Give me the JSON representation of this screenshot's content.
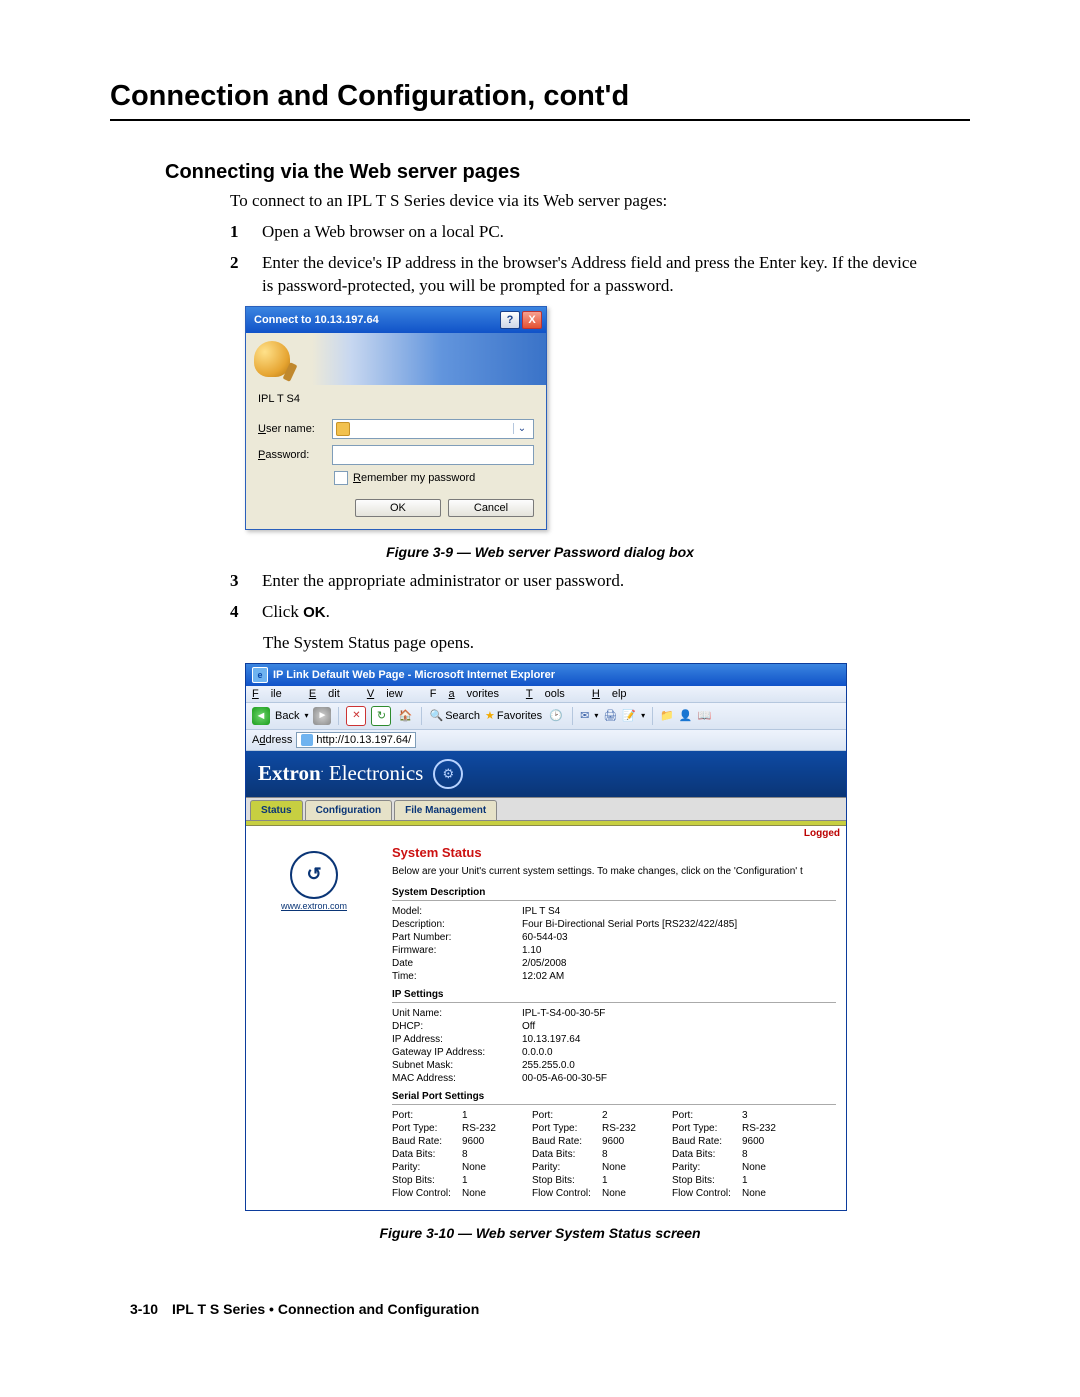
{
  "chapter_title": "Connection and Configuration, cont'd",
  "section_title": "Connecting via the Web server pages",
  "intro": "To connect to an IPL T S Series device via its Web server pages:",
  "steps_a": [
    {
      "n": "1",
      "t": "Open a Web browser on a local PC."
    },
    {
      "n": "2",
      "t": "Enter the device's IP address in the browser's Address field and press the Enter key.  If the device is password-protected, you will be prompted for a password."
    }
  ],
  "fig9_caption": "Figure 3-9 — Web server Password dialog box",
  "steps_b": [
    {
      "n": "3",
      "t": "Enter the appropriate administrator or user password."
    },
    {
      "n": "4",
      "t_pre": "Click ",
      "t_bold": "OK",
      "t_post": "."
    }
  ],
  "post_steps": "The System Status page opens.",
  "fig10_caption": "Figure 3-10 — Web server System Status screen",
  "footer_page": "3-10",
  "footer_text": "IPL T S Series • Connection and Configuration",
  "dlg": {
    "title": "Connect to 10.13.197.64",
    "help": "?",
    "close": "X",
    "header": "IPL T S4",
    "user_label_pre": "",
    "user_label_u": "U",
    "user_label_post": "ser name:",
    "pass_label_pre": "",
    "pass_label_u": "P",
    "pass_label_post": "assword:",
    "dd": "⌄",
    "remember_pre": "",
    "remember_u": "R",
    "remember_post": "emember my password",
    "ok": "OK",
    "cancel": "Cancel"
  },
  "ie": {
    "title": "IP Link Default Web Page - Microsoft Internet Explorer",
    "menu": {
      "file_u": "F",
      "file": "ile",
      "edit_u": "E",
      "edit": "dit",
      "view_u": "V",
      "view": "iew",
      "fav": "F",
      "fav2": "avorites",
      "tools_u": "T",
      "tools": "ools",
      "help_u": "H",
      "help": "elp"
    },
    "tool": {
      "back": "Back",
      "search": "Search",
      "favorites": "Favorites"
    },
    "addr_label_pre": "A",
    "addr_label_u": "d",
    "addr_label_post": "dress",
    "addr_value": "http://10.13.197.64/",
    "banner_brand": "Extron",
    "banner_dot": ".",
    "banner_sub": "Electronics",
    "banner_icon": "⚙",
    "tabs": [
      "Status",
      "Configuration",
      "File Management"
    ],
    "logged": "Logged",
    "side_url": "www.extron.com",
    "main_h": "System Status",
    "main_sub": "Below are your Unit's current system settings. To make changes, click on the 'Configuration' t",
    "sec1": "System Description",
    "sys": [
      {
        "k": "Model:",
        "v": "IPL T S4"
      },
      {
        "k": "Description:",
        "v": "Four Bi-Directional Serial Ports [RS232/422/485]"
      },
      {
        "k": "Part Number:",
        "v": "60-544-03"
      },
      {
        "k": "Firmware:",
        "v": "1.10"
      },
      {
        "k": "Date",
        "v": "2/05/2008"
      },
      {
        "k": "Time:",
        "v": "12:02 AM"
      }
    ],
    "sec2": "IP Settings",
    "ip": [
      {
        "k": "Unit Name:",
        "v": "IPL-T-S4-00-30-5F"
      },
      {
        "k": "DHCP:",
        "v": "Off"
      },
      {
        "k": "IP Address:",
        "v": "10.13.197.64"
      },
      {
        "k": "Gateway IP Address:",
        "v": "0.0.0.0"
      },
      {
        "k": "Subnet Mask:",
        "v": "255.255.0.0"
      },
      {
        "k": "MAC Address:",
        "v": "00-05-A6-00-30-5F"
      }
    ],
    "sec3": "Serial Port Settings",
    "port_labels": [
      "Port:",
      "Port Type:",
      "Baud Rate:",
      "Data Bits:",
      "Parity:",
      "Stop Bits:",
      "Flow Control:"
    ],
    "ports": [
      {
        "n": "1",
        "vals": [
          "1",
          "RS-232",
          "9600",
          "8",
          "None",
          "1",
          "None"
        ]
      },
      {
        "n": "2",
        "vals": [
          "2",
          "RS-232",
          "9600",
          "8",
          "None",
          "1",
          "None"
        ]
      },
      {
        "n": "3",
        "vals": [
          "3",
          "RS-232",
          "9600",
          "8",
          "None",
          "1",
          "None"
        ]
      }
    ]
  }
}
